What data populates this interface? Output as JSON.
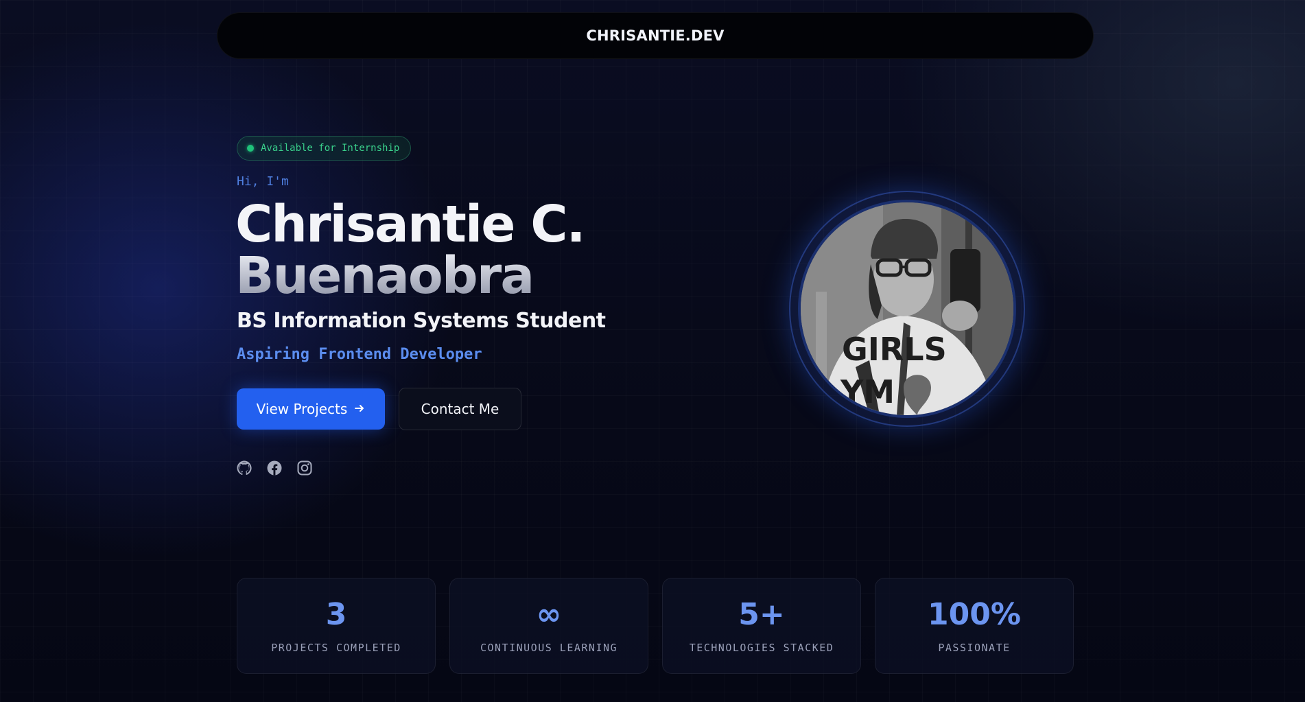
{
  "nav": {
    "brand": "CHRISANTIE.DEV"
  },
  "hero": {
    "badge": "Available for Internship",
    "greeting": "Hi, I'm",
    "name_line1": "Chrisantie C.",
    "name_line2": "Buenaobra",
    "role": "BS Information Systems Student",
    "tagline": "Aspiring Frontend Developer",
    "primary_button": "View Projects",
    "secondary_button": "Contact Me",
    "socials": [
      {
        "icon": "github-icon"
      },
      {
        "icon": "facebook-icon"
      },
      {
        "icon": "instagram-icon"
      }
    ]
  },
  "stats": [
    {
      "value": "3",
      "label": "PROJECTS COMPLETED"
    },
    {
      "value": "∞",
      "label": "CONTINUOUS LEARNING"
    },
    {
      "value": "5+",
      "label": "TECHNOLOGIES STACKED"
    },
    {
      "value": "100%",
      "label": "PASSIONATE"
    }
  ],
  "colors": {
    "accent": "#2360ef",
    "accent_text": "#5b8def",
    "status_green": "#1fc27a",
    "background": "#060818"
  }
}
